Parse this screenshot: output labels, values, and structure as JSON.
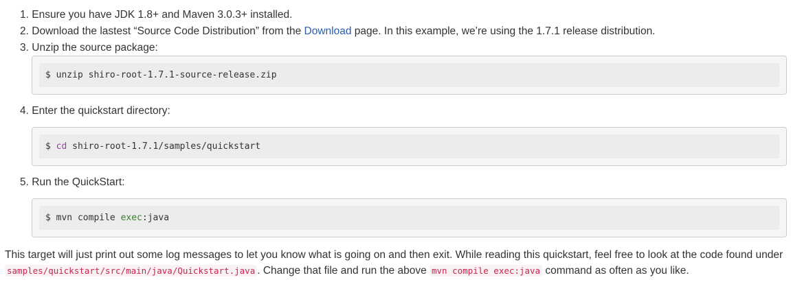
{
  "steps": [
    {
      "number": "1.",
      "text": "Ensure you have JDK 1.8+ and Maven 3.0.3+ installed."
    },
    {
      "number": "2.",
      "text_before": "Download the lastest “Source Code Distribution” from the ",
      "link": "Download",
      "text_after": " page. In this example, we’re using the 1.7.1 release distribution."
    },
    {
      "number": "3.",
      "text": "Unzip the source package:"
    },
    {
      "number": "4.",
      "text": "Enter the quickstart directory:"
    },
    {
      "number": "5.",
      "text": "Run the QuickStart:"
    }
  ],
  "code_blocks": [
    {
      "prompt": "$",
      "command": "unzip",
      "args": " shiro-root-1.7.1-source-release.zip"
    },
    {
      "prompt": "$",
      "command": "cd",
      "args": " shiro-root-1.7.1/samples/quickstart"
    },
    {
      "prompt": "$",
      "command": "mvn compile",
      "args_highlight": "exec",
      "args_rest": ":java"
    }
  ],
  "paragraph": {
    "part1": "This target will just print out some log messages to let you know what is going on and then exit. While reading this quickstart, feel free to look at the code found under ",
    "code1": "samples/quickstart/src/main/java/Quickstart.java",
    "part2": ". Change that file and run the above ",
    "code2": "mvn compile exec:java",
    "part3": " command as often as you like."
  },
  "colors": {
    "link": "#2a5db0",
    "inline_code_text": "#c7254e",
    "inline_code_bg": "#f9f2f4",
    "code_block_bg": "#f5f5f5"
  }
}
